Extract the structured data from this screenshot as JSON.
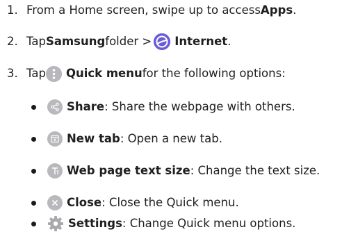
{
  "steps": [
    {
      "num": "1.",
      "pre": "From a Home screen, swipe up to access ",
      "bold": "Apps",
      "post": "."
    },
    {
      "num": "2.",
      "pre": "Tap ",
      "bold1": "Samsung",
      "mid": " folder > ",
      "bold2": "Internet",
      "post": ".",
      "icon": "internet-app-icon"
    },
    {
      "num": "3.",
      "pre": "Tap ",
      "bold": "Quick menu",
      "post": " for the following options:",
      "icon": "quick-menu-icon"
    }
  ],
  "options": [
    {
      "icon": "share-icon",
      "label": "Share",
      "desc": ": Share the webpage with others."
    },
    {
      "icon": "new-tab-icon",
      "label": "New tab",
      "desc": ": Open a new tab."
    },
    {
      "icon": "text-size-icon",
      "label": "Web page text size",
      "desc": ": Change the text size."
    },
    {
      "icon": "close-icon",
      "label": "Close",
      "desc": ": Close the Quick menu."
    },
    {
      "icon": "settings-icon",
      "label": "Settings",
      "desc": ": Change Quick menu options."
    }
  ],
  "colors": {
    "text": "#1f1f1f",
    "icon_gray": "#b9b9bd",
    "quick_menu_icon": "#b8b8bc",
    "internet_icon": "#6b5bd6"
  }
}
